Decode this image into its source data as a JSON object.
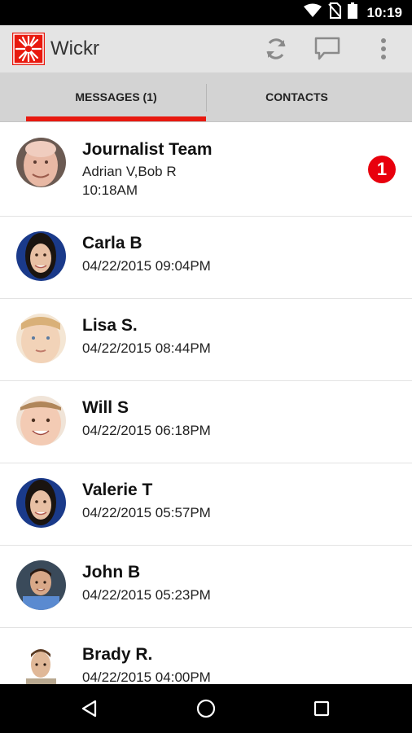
{
  "status_bar": {
    "time": "10:19",
    "icons": [
      "wifi-icon",
      "no-sim-icon",
      "battery-icon"
    ]
  },
  "app_bar": {
    "title": "Wickr",
    "logo_icon": "wickr-star-logo",
    "actions": [
      "refresh-icon",
      "new-message-icon",
      "overflow-menu-icon"
    ],
    "accent_color": "#e8190f"
  },
  "tabs": [
    {
      "label": "MESSAGES (1)",
      "selected": true
    },
    {
      "label": "CONTACTS",
      "selected": false
    }
  ],
  "conversations": [
    {
      "name": "Journalist Team",
      "members": "Adrian V,Bob R",
      "time": "10:18AM",
      "unread": "1",
      "avatar": "bald-man"
    },
    {
      "name": "Carla B",
      "time": "04/22/2015 09:04PM",
      "avatar": "dark-hair-woman"
    },
    {
      "name": "Lisa S.",
      "time": "04/22/2015 08:44PM",
      "avatar": "blonde-woman"
    },
    {
      "name": "Will S",
      "time": "04/22/2015 06:18PM",
      "avatar": "young-boy"
    },
    {
      "name": "Valerie T",
      "time": "04/22/2015 05:57PM",
      "avatar": "dark-hair-woman"
    },
    {
      "name": "John B",
      "time": "04/22/2015 05:23PM",
      "avatar": "man-blue-shirt"
    },
    {
      "name": "Brady R.",
      "time": "04/22/2015 04:00PM",
      "avatar": "young-man"
    }
  ],
  "nav_bar": {
    "buttons": [
      "back-icon",
      "home-icon",
      "recents-icon"
    ]
  }
}
